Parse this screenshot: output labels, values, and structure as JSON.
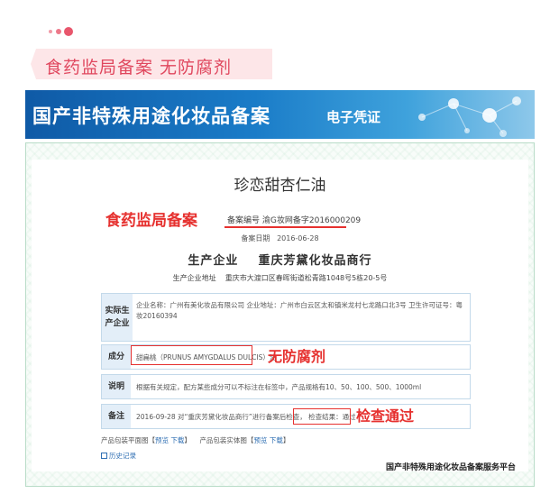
{
  "header": {
    "title": "食药监局备案  无防腐剂"
  },
  "banner": {
    "title": "国产非特殊用途化妆品备案",
    "subtitle": "电子凭证"
  },
  "certificate": {
    "product_name": "珍恋甜杏仁油",
    "reg_number_label": "备案编号",
    "reg_number": "渝G妆网备字2016000209",
    "reg_date_label": "备案日期",
    "reg_date": "2016-06-28",
    "producer_label": "生产企业",
    "producer": "重庆芳黛化妆品商行",
    "address_label": "生产企业地址",
    "address": "重庆市大渡口区春晖街道松青路1048号5栋20-5号",
    "rows": [
      {
        "label": "实际生产企业",
        "content": "企业名称：广州有美化妆品有限公司    企业地址：广州市白云区太和镇米龙村七龙路口北3号    卫生许可证号：粤妆20160394"
      },
      {
        "label": "成分",
        "content": "甜扁桃（PRUNUS AMYGDALUS DULCIS）油"
      },
      {
        "label": "说明",
        "content": "根据有关规定，配方某些成分可以不标注在标签中，产品规格有10、50、100、500、1000ml"
      },
      {
        "label": "备注",
        "content": "2016-09-28 对“重庆芳黛化妆品商行”进行备案后检查，",
        "result": "检查结果：通过"
      }
    ],
    "package": {
      "front_label": "产品包装平面图【",
      "front_view": "预览",
      "front_download": "下载",
      "front_end": "】",
      "real_label": "产品包装实体图【",
      "real_view": "预览",
      "real_download": "下载",
      "real_end": "】"
    },
    "history": "历史记录",
    "platform": "国产非特殊用途化妆品备案服务平台"
  },
  "annotations": {
    "fda_filing": "食药监局备案",
    "no_preservative": "无防腐剂",
    "inspection_passed": "检查通过"
  }
}
